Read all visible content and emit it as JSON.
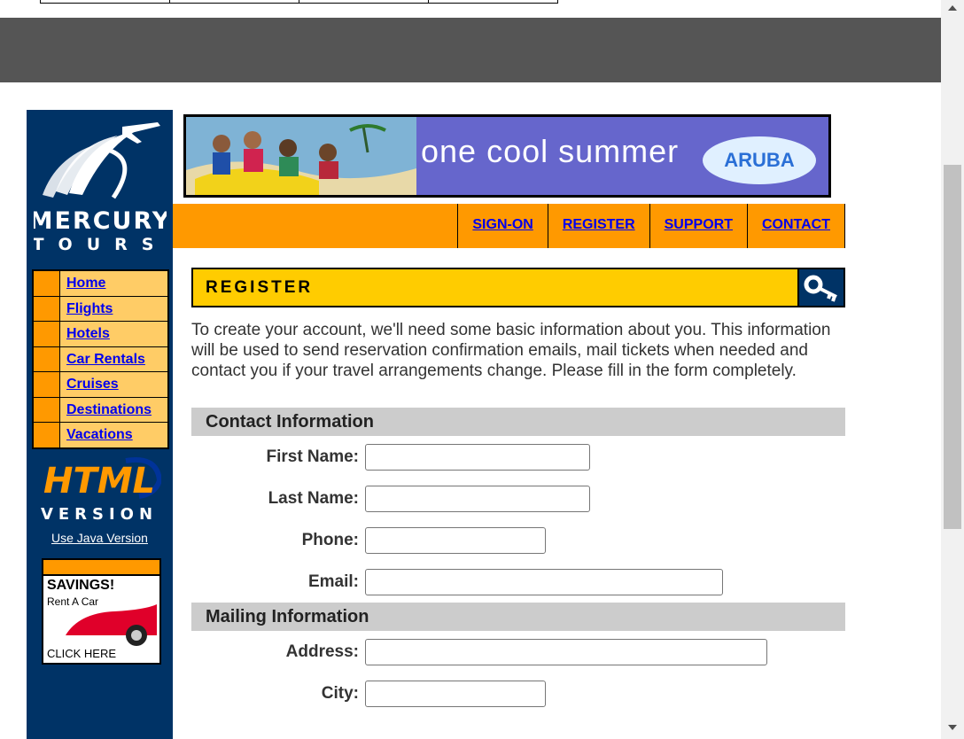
{
  "colors": {
    "sidebar_bg": "#003366",
    "nav_orange": "#ff9900",
    "nav_light": "#ffcc66",
    "header_yellow": "#ffcc00",
    "link_blue": "#0000ee",
    "section_grey": "#cccccc",
    "top_band": "#555555"
  },
  "logo": {
    "line1": "MERCURY",
    "line2": "TOURS"
  },
  "sidebar": {
    "items": [
      {
        "label": "Home"
      },
      {
        "label": "Flights"
      },
      {
        "label": "Hotels"
      },
      {
        "label": "Car Rentals"
      },
      {
        "label": "Cruises"
      },
      {
        "label": "Destinations"
      },
      {
        "label": "Vacations"
      }
    ],
    "html_version_line1": "HTML",
    "html_version_line2": "VERSION",
    "java_link": "Use Java Version",
    "ad": {
      "title": "SAVINGS!",
      "subtitle": "Rent A Car",
      "cta": "CLICK HERE"
    }
  },
  "banner": {
    "text": "one cool summer",
    "brand": "ARUBA"
  },
  "topnav": {
    "items": [
      "SIGN-ON",
      "REGISTER",
      "SUPPORT",
      "CONTACT"
    ]
  },
  "page": {
    "title": "REGISTER",
    "intro": "To create your account, we'll need some basic information about you. This information will be used to send reservation confirmation emails, mail tickets when needed and contact you if your travel arrangements change. Please fill in the form completely."
  },
  "form": {
    "contact_section": "Contact Information",
    "first_name_label": "First Name:",
    "last_name_label": "Last Name:",
    "phone_label": "Phone:",
    "email_label": "Email:",
    "mailing_section": "Mailing Information",
    "address_label": "Address:",
    "city_label": "City:"
  }
}
